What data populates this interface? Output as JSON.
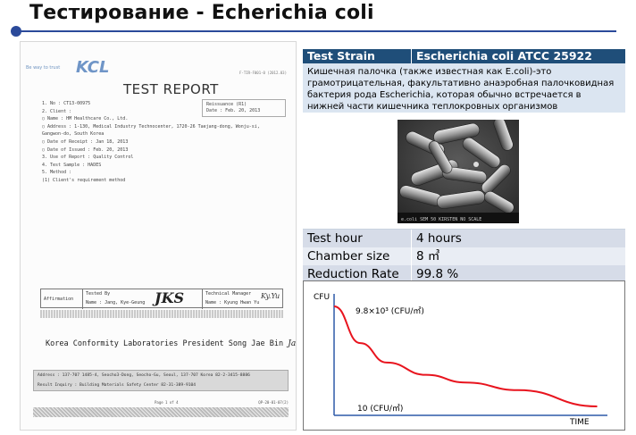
{
  "slide": {
    "title": "Тестирование - Echerichia coli",
    "accent_color": "#2b4a9a"
  },
  "report": {
    "tagline": "Be way to trust",
    "logo": "KCL",
    "doc_code": "F-TIR-F001-0 (2012.03)",
    "title": "TEST REPORT",
    "stamp": {
      "line1": "Reissuance (R1)",
      "line2": "Date : Feb. 20, 2013"
    },
    "fields": [
      "1. No :          CT13-00975",
      "2. Client :",
      "   ○ Name :  HM Healthcare Co., Ltd.",
      "   ○ Address :  1-130, Medical Industry Technocenter, 1720-26 Taejang-dong, Wonju-si,",
      "                Gangwon-do, South Korea",
      "   ○ Date of Receipt :  Jan 18, 2013",
      "   ○ Date of Issued :  Feb. 20, 2013",
      "3. Use of Report :          Quality Control",
      "4. Test Sample :  HADES",
      "5. Method :",
      "   (1) Client's requirement method"
    ],
    "affirmation": {
      "label": "Affirmation",
      "tested_by_label": "Tested By",
      "tested_by_name": "Name :  Jang, Kye-Geung",
      "manager_label": "Technical Manager",
      "manager_name": "Name :  Kyung Hwan Yu",
      "mark": "JKS",
      "sign": "Ky.Yu"
    },
    "lab_line": "Korea Conformity Laboratories     President  Song Jae Bin",
    "president_sign": "Jae Bin Song",
    "address_line": "Address  :  137-707 1485-4, Seocho3-Dong, Seocho-Gu, Seoul, 137-707 Korea 82-2-3415-8886",
    "inquiry_line": "Result Inquiry : Building Materials Safety Center  82-31-389-9104",
    "page": "Page 1 of 4",
    "footer_code": "QP-20-01-07(2)"
  },
  "info_table": {
    "header_label": "Test Strain",
    "header_value": "Escherichia coli ATCC 25922",
    "description": "Кишечная палочка (также известная как E.coli)-это грамотрицательная, факультативно анаэробная палочковидная бактерия рода Escherichia, которая обычно встречается в нижней части кишечника теплокровных организмов (эндотермов).",
    "photo_caption": "e.coli  SEM  50  KIRSTEN  NO  SCALE",
    "rows": [
      {
        "label": "Test hour",
        "value": "4 hours"
      },
      {
        "label": "Chamber size",
        "value": "8  ㎥"
      },
      {
        "label": "Reduction Rate",
        "value": "99.8 %"
      }
    ],
    "header_color": "#1f4e79"
  },
  "chart_data": {
    "type": "line",
    "ylabel": "CFU",
    "xlabel": "TIME",
    "start_label": "9.8×10³ (CFU/㎥)",
    "end_label": "10 (CFU/㎥)",
    "x": [
      0,
      0.1,
      0.2,
      0.35,
      0.5,
      0.7,
      1.0
    ],
    "y": [
      9800,
      6200,
      4300,
      3100,
      2350,
      1600,
      10
    ],
    "line_color": "#e8141e",
    "grid": false
  }
}
